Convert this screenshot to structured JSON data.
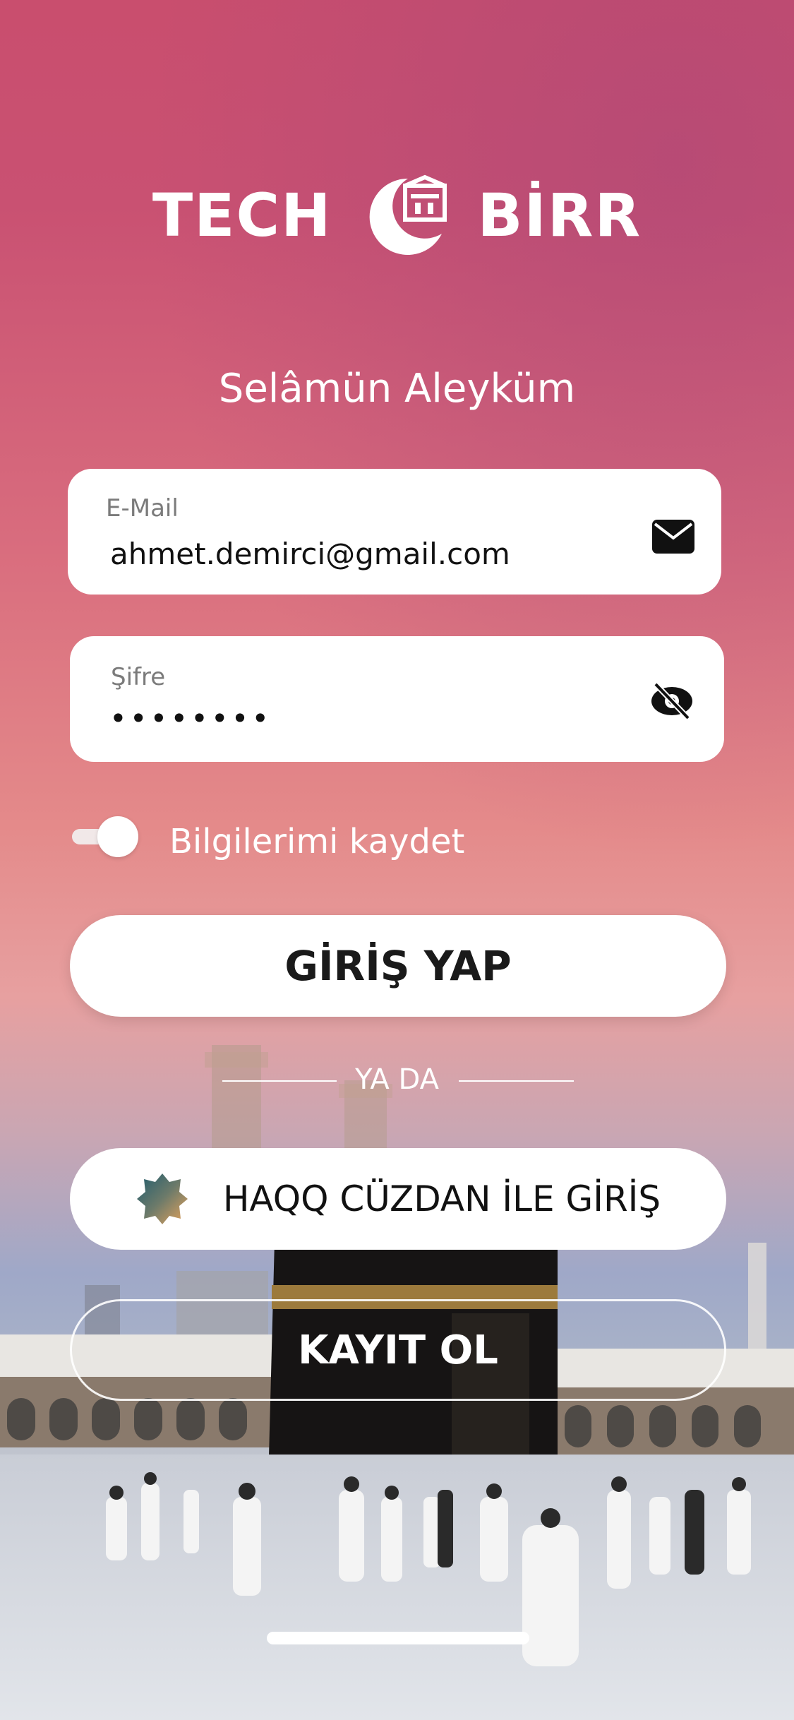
{
  "brand": {
    "left_word": "TECH",
    "right_word": "BİRR",
    "logo_icon": "crescent-kaaba-icon"
  },
  "greeting": "Selâmün Aleyküm",
  "email_field": {
    "label": "E-Mail",
    "value": "ahmet.demirci@gmail.com",
    "icon": "envelope-icon"
  },
  "password_field": {
    "label": "Şifre",
    "value": "••••••••",
    "icon": "eye-off-icon"
  },
  "remember_toggle": {
    "label": "Bilgilerimi kaydet",
    "state": "on"
  },
  "buttons": {
    "login": "GİRİŞ YAP",
    "divider": "YA DA",
    "haqq_wallet": "HAQQ CÜZDAN İLE GİRİŞ",
    "register": "KAYIT OL"
  },
  "colors": {
    "gradient_top": "#c94e6e",
    "gradient_mid": "#e48a8a",
    "button_bg": "#ffffff",
    "text_dark": "#1a1a1a"
  }
}
